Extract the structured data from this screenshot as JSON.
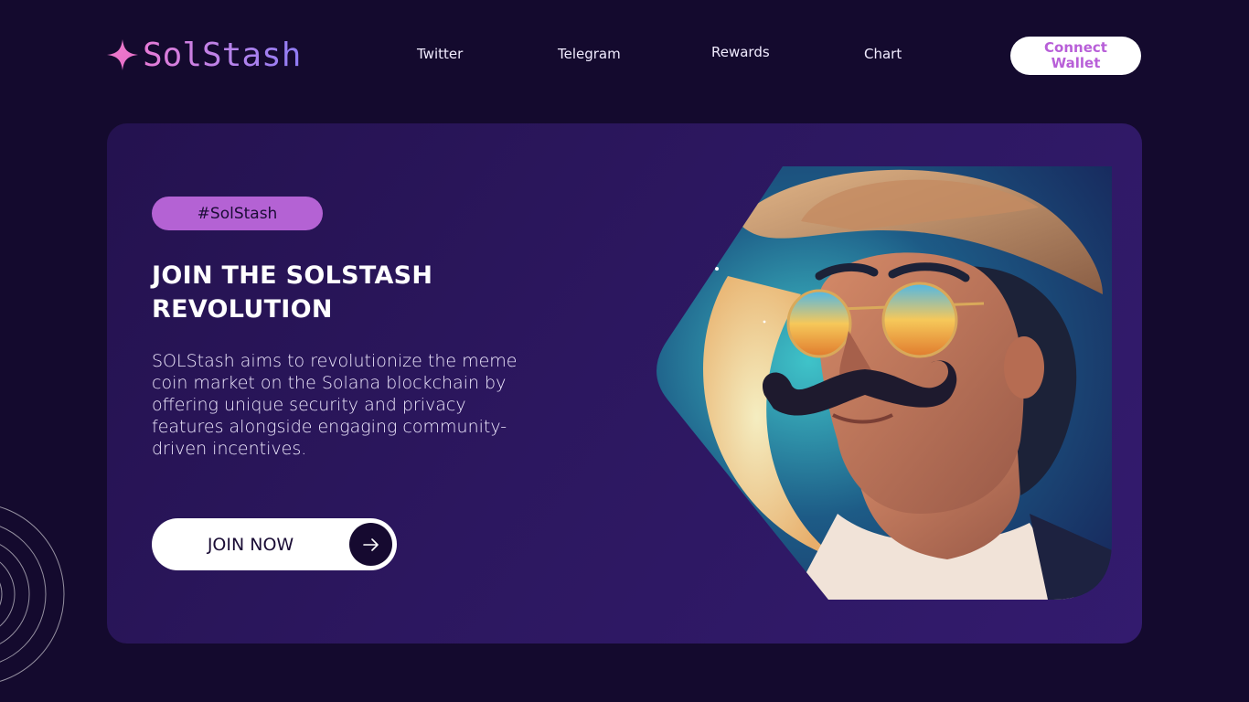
{
  "brand": {
    "name": "SolStash",
    "logo_icon": "sparkle-star-icon"
  },
  "nav": {
    "links": [
      "Twitter",
      "Telegram",
      "Rewards",
      "Chart"
    ]
  },
  "header": {
    "connect_label": "Connect Wallet"
  },
  "hero": {
    "tag": "#SolStash",
    "headline_line1": "JOIN THE SOLSTASH",
    "headline_line2": "REVOLUTION",
    "description": "SOLStash aims to revolutionize the meme coin market on the Solana blockchain by offering unique security and privacy features alongside engaging community-driven incentives.",
    "cta_label": "JOIN NOW",
    "cta_icon": "arrow-right-icon",
    "image_subject": "mascot-portrait-illustration"
  },
  "colors": {
    "page_bg": "#140a2e",
    "card_bg": "#2c175f",
    "accent": "#b462d4",
    "logo_pink": "#e77bd7",
    "logo_violet": "#8f7cf5"
  }
}
